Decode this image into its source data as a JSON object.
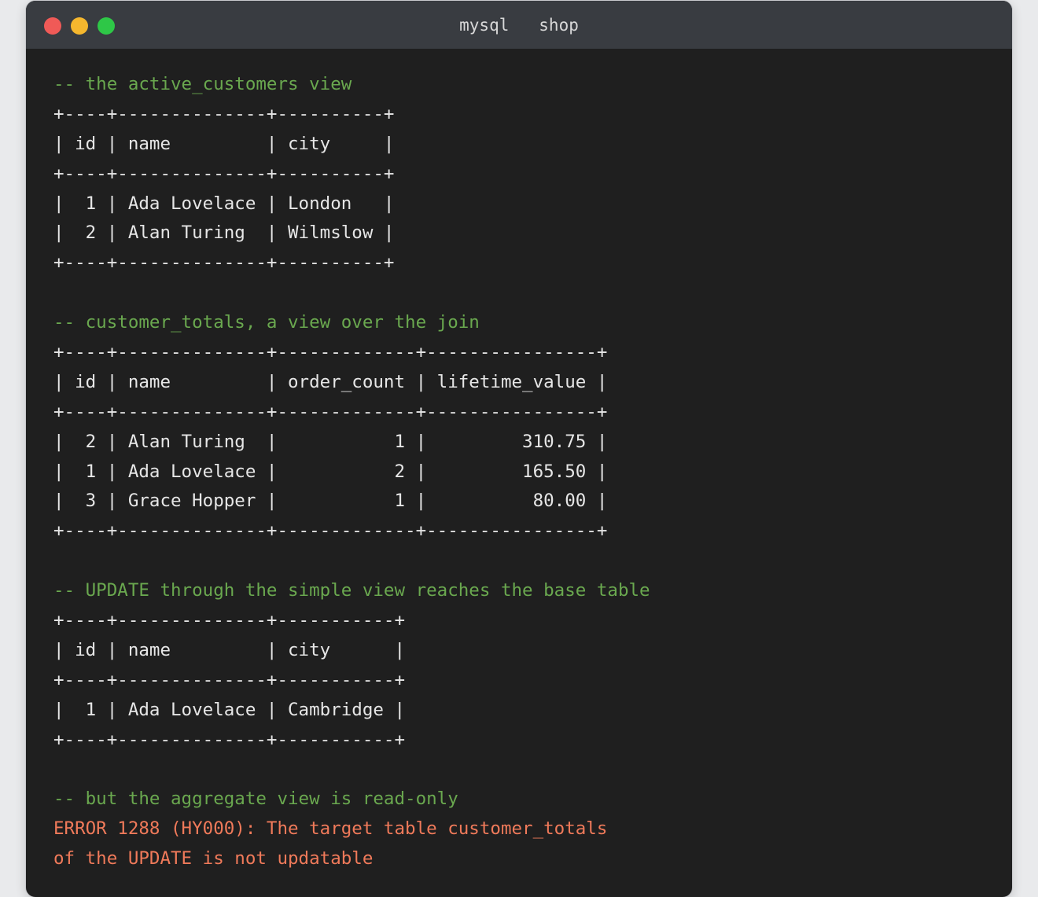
{
  "window": {
    "title": "mysql   shop"
  },
  "terminal": {
    "lines": [
      {
        "kind": "comment",
        "text": "-- the active_customers view"
      },
      {
        "kind": "output",
        "text": "+----+--------------+----------+"
      },
      {
        "kind": "output",
        "text": "| id | name         | city     |"
      },
      {
        "kind": "output",
        "text": "+----+--------------+----------+"
      },
      {
        "kind": "output",
        "text": "|  1 | Ada Lovelace | London   |"
      },
      {
        "kind": "output",
        "text": "|  2 | Alan Turing  | Wilmslow |"
      },
      {
        "kind": "output",
        "text": "+----+--------------+----------+"
      },
      {
        "kind": "blank",
        "text": ""
      },
      {
        "kind": "comment",
        "text": "-- customer_totals, a view over the join"
      },
      {
        "kind": "output",
        "text": "+----+--------------+-------------+----------------+"
      },
      {
        "kind": "output",
        "text": "| id | name         | order_count | lifetime_value |"
      },
      {
        "kind": "output",
        "text": "+----+--------------+-------------+----------------+"
      },
      {
        "kind": "output",
        "text": "|  2 | Alan Turing  |           1 |         310.75 |"
      },
      {
        "kind": "output",
        "text": "|  1 | Ada Lovelace |           2 |         165.50 |"
      },
      {
        "kind": "output",
        "text": "|  3 | Grace Hopper |           1 |          80.00 |"
      },
      {
        "kind": "output",
        "text": "+----+--------------+-------------+----------------+"
      },
      {
        "kind": "blank",
        "text": ""
      },
      {
        "kind": "comment",
        "text": "-- UPDATE through the simple view reaches the base table"
      },
      {
        "kind": "output",
        "text": "+----+--------------+-----------+"
      },
      {
        "kind": "output",
        "text": "| id | name         | city      |"
      },
      {
        "kind": "output",
        "text": "+----+--------------+-----------+"
      },
      {
        "kind": "output",
        "text": "|  1 | Ada Lovelace | Cambridge |"
      },
      {
        "kind": "output",
        "text": "+----+--------------+-----------+"
      },
      {
        "kind": "blank",
        "text": ""
      },
      {
        "kind": "comment",
        "text": "-- but the aggregate view is read-only"
      },
      {
        "kind": "error",
        "text": "ERROR 1288 (HY000): The target table customer_totals"
      },
      {
        "kind": "error",
        "text": "of the UPDATE is not updatable"
      }
    ]
  }
}
